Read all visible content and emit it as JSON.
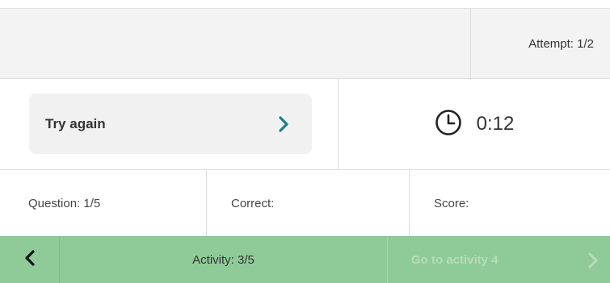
{
  "header": {
    "attempt": "Attempt: 1/2"
  },
  "action": {
    "try_again_label": "Try again",
    "timer": "0:12"
  },
  "stats": {
    "question": "Question: 1/5",
    "correct": "Correct:",
    "score": "Score:"
  },
  "footer": {
    "activity": "Activity: 3/5",
    "next_label": "Go to activity 4"
  },
  "icons": {
    "try_again_chevron": "chevron-right-icon",
    "timer": "clock-icon",
    "prev": "chevron-left-icon",
    "next": "chevron-right-icon"
  },
  "colors": {
    "accent": "#1e7e8c",
    "footer_bg": "#8fcb98",
    "panel_bg": "#f3f3f3",
    "button_bg": "#f1f1f1",
    "disabled_text": "#b6dcbb"
  }
}
